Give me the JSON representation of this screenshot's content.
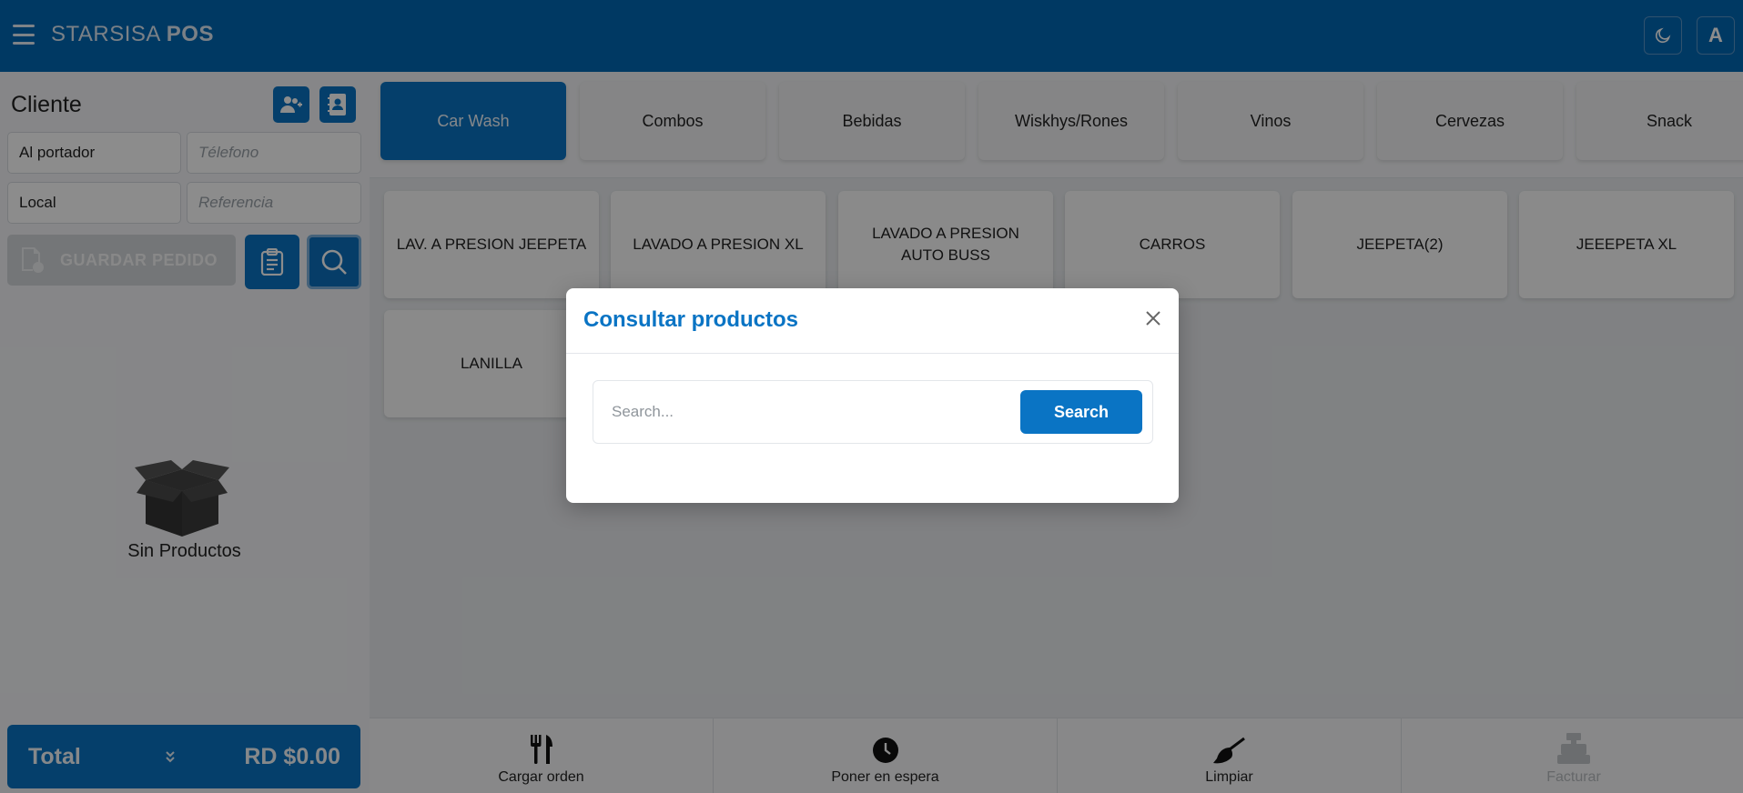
{
  "app": {
    "brand_prefix": "STARSISA",
    "brand_suffix": "POS",
    "avatar_letter": "A"
  },
  "client": {
    "title": "Cliente",
    "name_value": "Al portador",
    "phone_placeholder": "Télefono",
    "location_value": "Local",
    "reference_placeholder": "Referencia",
    "save_label": "GUARDAR PEDIDO"
  },
  "cart": {
    "empty_label": "Sin Productos",
    "total_label": "Total",
    "total_amount": "RD $0.00"
  },
  "categories": [
    {
      "label": "Car Wash",
      "active": true
    },
    {
      "label": "Combos"
    },
    {
      "label": "Bebidas"
    },
    {
      "label": "Wiskhys/Rones"
    },
    {
      "label": "Vinos"
    },
    {
      "label": "Cervezas"
    },
    {
      "label": "Snack"
    }
  ],
  "products": [
    {
      "label": "LAV. A PRESION JEEPETA"
    },
    {
      "label": "LAVADO A PRESION XL"
    },
    {
      "label": "LAVADO A PRESION AUTO BUSS"
    },
    {
      "label": "CARROS"
    },
    {
      "label": "JEEPETA(2)"
    },
    {
      "label": "JEEEPETA XL"
    },
    {
      "label": "LANILLA"
    }
  ],
  "actions": [
    {
      "label": "Cargar orden",
      "icon": "fork-knife-icon"
    },
    {
      "label": "Poner en espera",
      "icon": "clock-icon"
    },
    {
      "label": "Limpiar",
      "icon": "broom-icon"
    },
    {
      "label": "Facturar",
      "icon": "cash-register-icon",
      "disabled": true
    }
  ],
  "modal": {
    "title": "Consultar productos",
    "search_placeholder": "Search...",
    "search_button": "Search"
  },
  "colors": {
    "primary": "#0a74c4",
    "topbar": "#0069b4",
    "overlay": "rgba(0,0,0,0.45)"
  }
}
